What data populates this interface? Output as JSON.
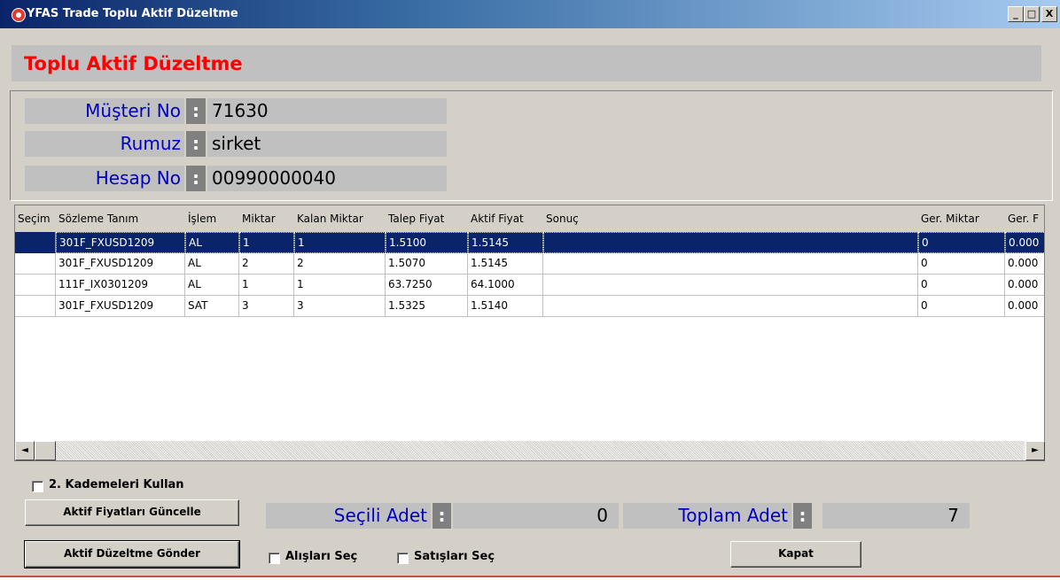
{
  "window": {
    "title": "YFAS Trade Toplu Aktif Düzeltme",
    "minimize": "_",
    "maximize": "□",
    "close": "X"
  },
  "header": {
    "title": "Toplu Aktif Düzeltme"
  },
  "info": {
    "colon": ":",
    "rows": [
      {
        "label": "Müşteri No",
        "value": "71630"
      },
      {
        "label": "Rumuz",
        "value": "sirket"
      },
      {
        "label": "Hesap No",
        "value": "00990000040"
      }
    ]
  },
  "grid": {
    "columns": [
      "Seçim",
      "Sözleme Tanım",
      "İşlem",
      "Miktar",
      "Kalan Miktar",
      "Talep Fiyat",
      "Aktif Fiyat",
      "Sonuç",
      "Ger. Miktar",
      "Ger. F"
    ],
    "rows": [
      {
        "secim": "",
        "tanim": "301F_FXUSD1209",
        "islem": "AL",
        "miktar": "1",
        "kalan": "1",
        "talep": "1.5100",
        "aktif": "1.5145",
        "sonuc": "",
        "ger_miktar": "0",
        "ger_f": "0.000"
      },
      {
        "secim": "",
        "tanim": "301F_FXUSD1209",
        "islem": "AL",
        "miktar": "2",
        "kalan": "2",
        "talep": "1.5070",
        "aktif": "1.5145",
        "sonuc": "",
        "ger_miktar": "0",
        "ger_f": "0.000"
      },
      {
        "secim": "",
        "tanim": "111F_IX0301209",
        "islem": "AL",
        "miktar": "1",
        "kalan": "1",
        "talep": "63.7250",
        "aktif": "64.1000",
        "sonuc": "",
        "ger_miktar": "0",
        "ger_f": "0.000"
      },
      {
        "secim": "",
        "tanim": "301F_FXUSD1209",
        "islem": "SAT",
        "miktar": "3",
        "kalan": "3",
        "talep": "1.5325",
        "aktif": "1.5140",
        "sonuc": "",
        "ger_miktar": "0",
        "ger_f": "0.000"
      }
    ],
    "selected_row": 0,
    "scroll_left": "◄",
    "scroll_right": "►"
  },
  "options": {
    "kademe_label": "2. Kademeleri Kullan",
    "alis_label": "Alışları Seç",
    "satis_label": "Satışları Seç"
  },
  "buttons": {
    "guncelle": "Aktif Fiyatları Güncelle",
    "gonder": "Aktif Düzeltme Gönder",
    "kapat": "Kapat"
  },
  "stats": {
    "colon": ":",
    "secili_label": "Seçili Adet",
    "secili_value": "0",
    "toplam_label": "Toplam Adet",
    "toplam_value": "7"
  }
}
